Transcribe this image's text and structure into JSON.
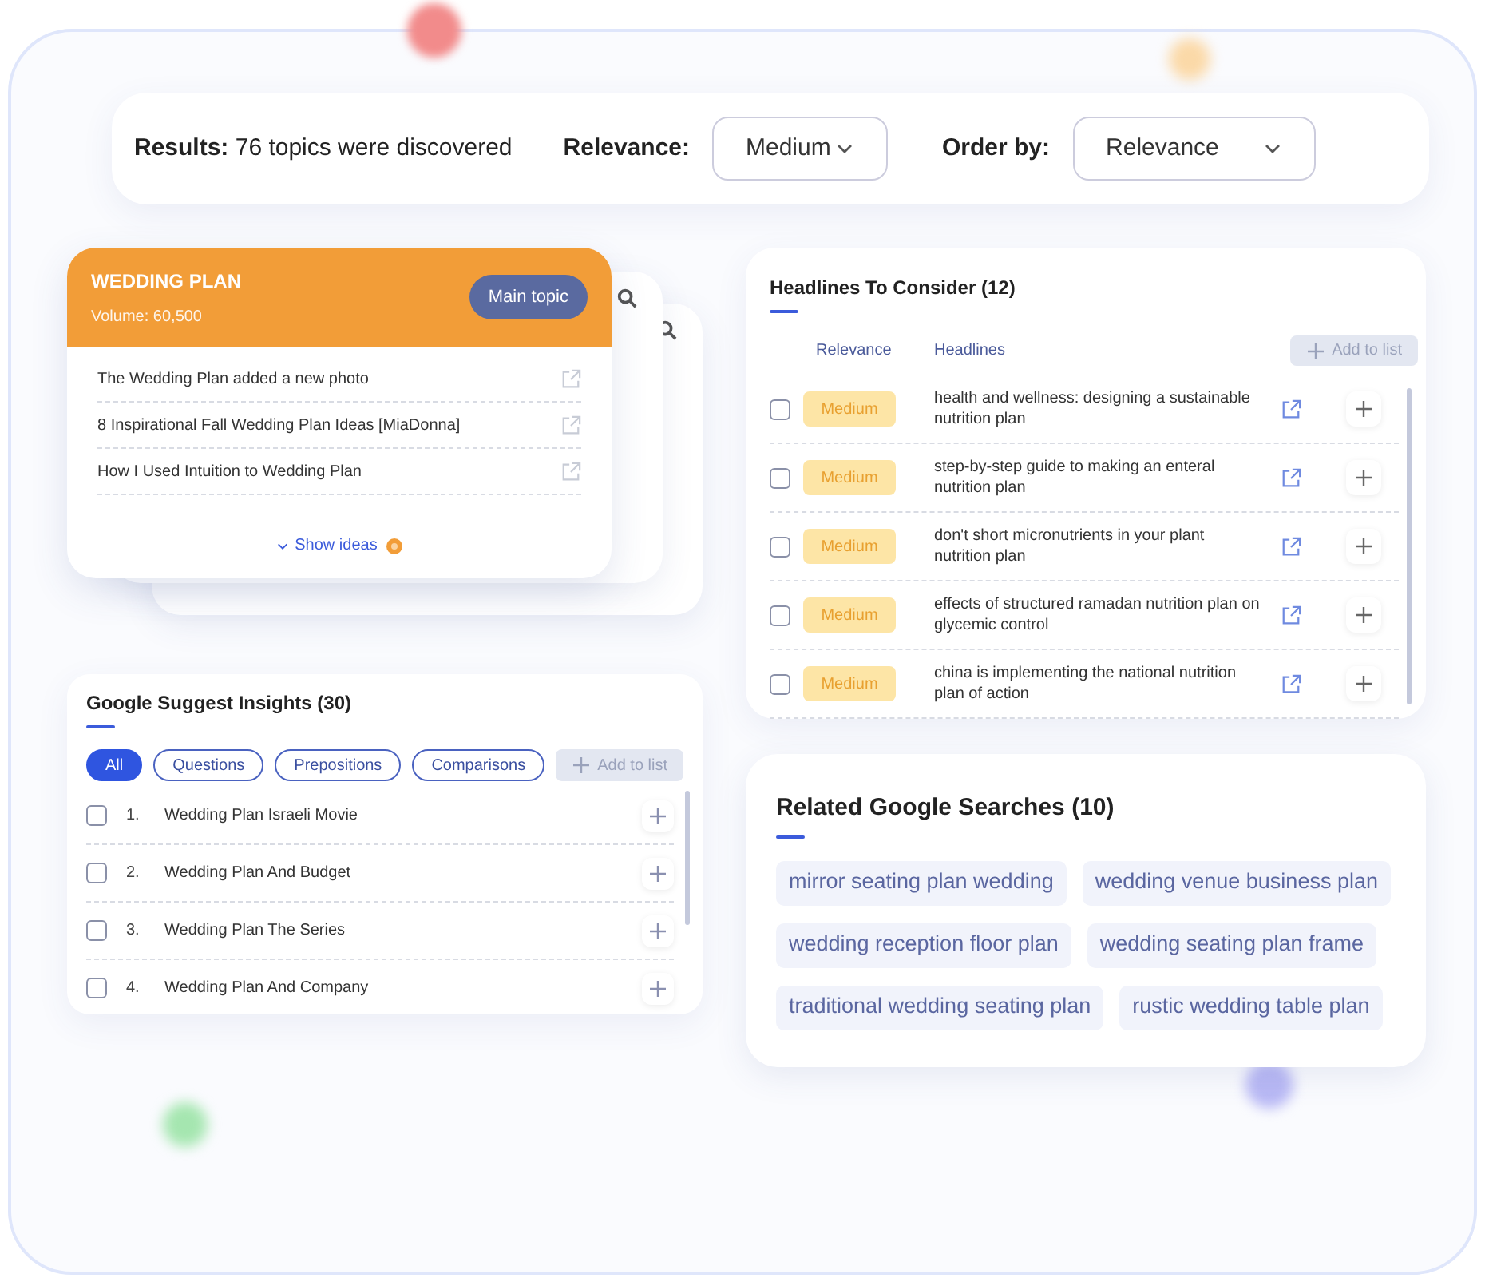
{
  "toolbar": {
    "results_label": "Results:",
    "results_text": "76 topics were discovered",
    "relevance": {
      "label": "Relevance:",
      "value": "Medium"
    },
    "order_by": {
      "label": "Order by:",
      "value": "Relevance"
    }
  },
  "topic_card": {
    "title": "WEDDING PLAN",
    "volume": "Volume: 60,500",
    "badge": "Main topic",
    "items": [
      "The Wedding Plan added a new photo",
      "8 Inspirational Fall Wedding Plan Ideas [MiaDonna]",
      "How I Used Intuition to Wedding Plan"
    ],
    "show_ideas": "Show ideas"
  },
  "headlines": {
    "title": "Headlines To Consider (12)",
    "columns": [
      "Relevance",
      "Headlines"
    ],
    "add_button": {
      "label": "Add to list",
      "disabled": true
    },
    "rows": [
      {
        "checked": false,
        "relevance": "Medium",
        "text": "health and wellness: designing a sustainable nutrition plan"
      },
      {
        "checked": false,
        "relevance": "Medium",
        "text": "step-by-step guide to making an enteral nutrition plan"
      },
      {
        "checked": false,
        "relevance": "Medium",
        "text": "don't short micronutrients in your plant nutrition plan"
      },
      {
        "checked": false,
        "relevance": "Medium",
        "text": "effects of structured ramadan nutrition plan on glycemic control"
      },
      {
        "checked": false,
        "relevance": "Medium",
        "text": "china is implementing the national nutrition plan of action"
      }
    ]
  },
  "suggest": {
    "title": "Google Suggest Insights (30)",
    "filters": [
      {
        "label": "All",
        "selected": true
      },
      {
        "label": "Questions",
        "selected": false
      },
      {
        "label": "Prepositions",
        "selected": false
      },
      {
        "label": "Comparisons",
        "selected": false
      }
    ],
    "add_button": {
      "label": "Add to list",
      "disabled": true
    },
    "rows": [
      {
        "checked": false,
        "number": "1.",
        "text": "Wedding Plan Israeli Movie"
      },
      {
        "checked": false,
        "number": "2.",
        "text": "Wedding Plan And Budget"
      },
      {
        "checked": false,
        "number": "3.",
        "text": "Wedding Plan The Series"
      },
      {
        "checked": false,
        "number": "4.",
        "text": "Wedding Plan And Company"
      }
    ]
  },
  "related": {
    "title": "Related Google Searches (10)",
    "chips": [
      "mirror seating plan wedding",
      "wedding venue business plan",
      "wedding reception floor plan",
      "wedding seating plan frame",
      "traditional wedding seating plan",
      "rustic wedding table plan"
    ]
  }
}
